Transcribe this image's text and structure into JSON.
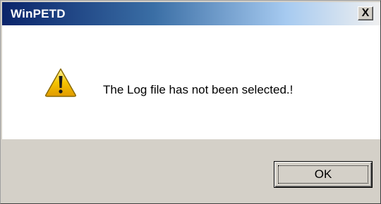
{
  "window": {
    "title": "WinPETD",
    "close_glyph": "X"
  },
  "dialog": {
    "icon": "warning-icon",
    "message": "The Log file has not been selected.!",
    "ok_label": "OK"
  },
  "colors": {
    "title_bar_start": "#0a246a",
    "title_bar_end": "#f0f0f0",
    "warning_yellow": "#f5c400"
  }
}
